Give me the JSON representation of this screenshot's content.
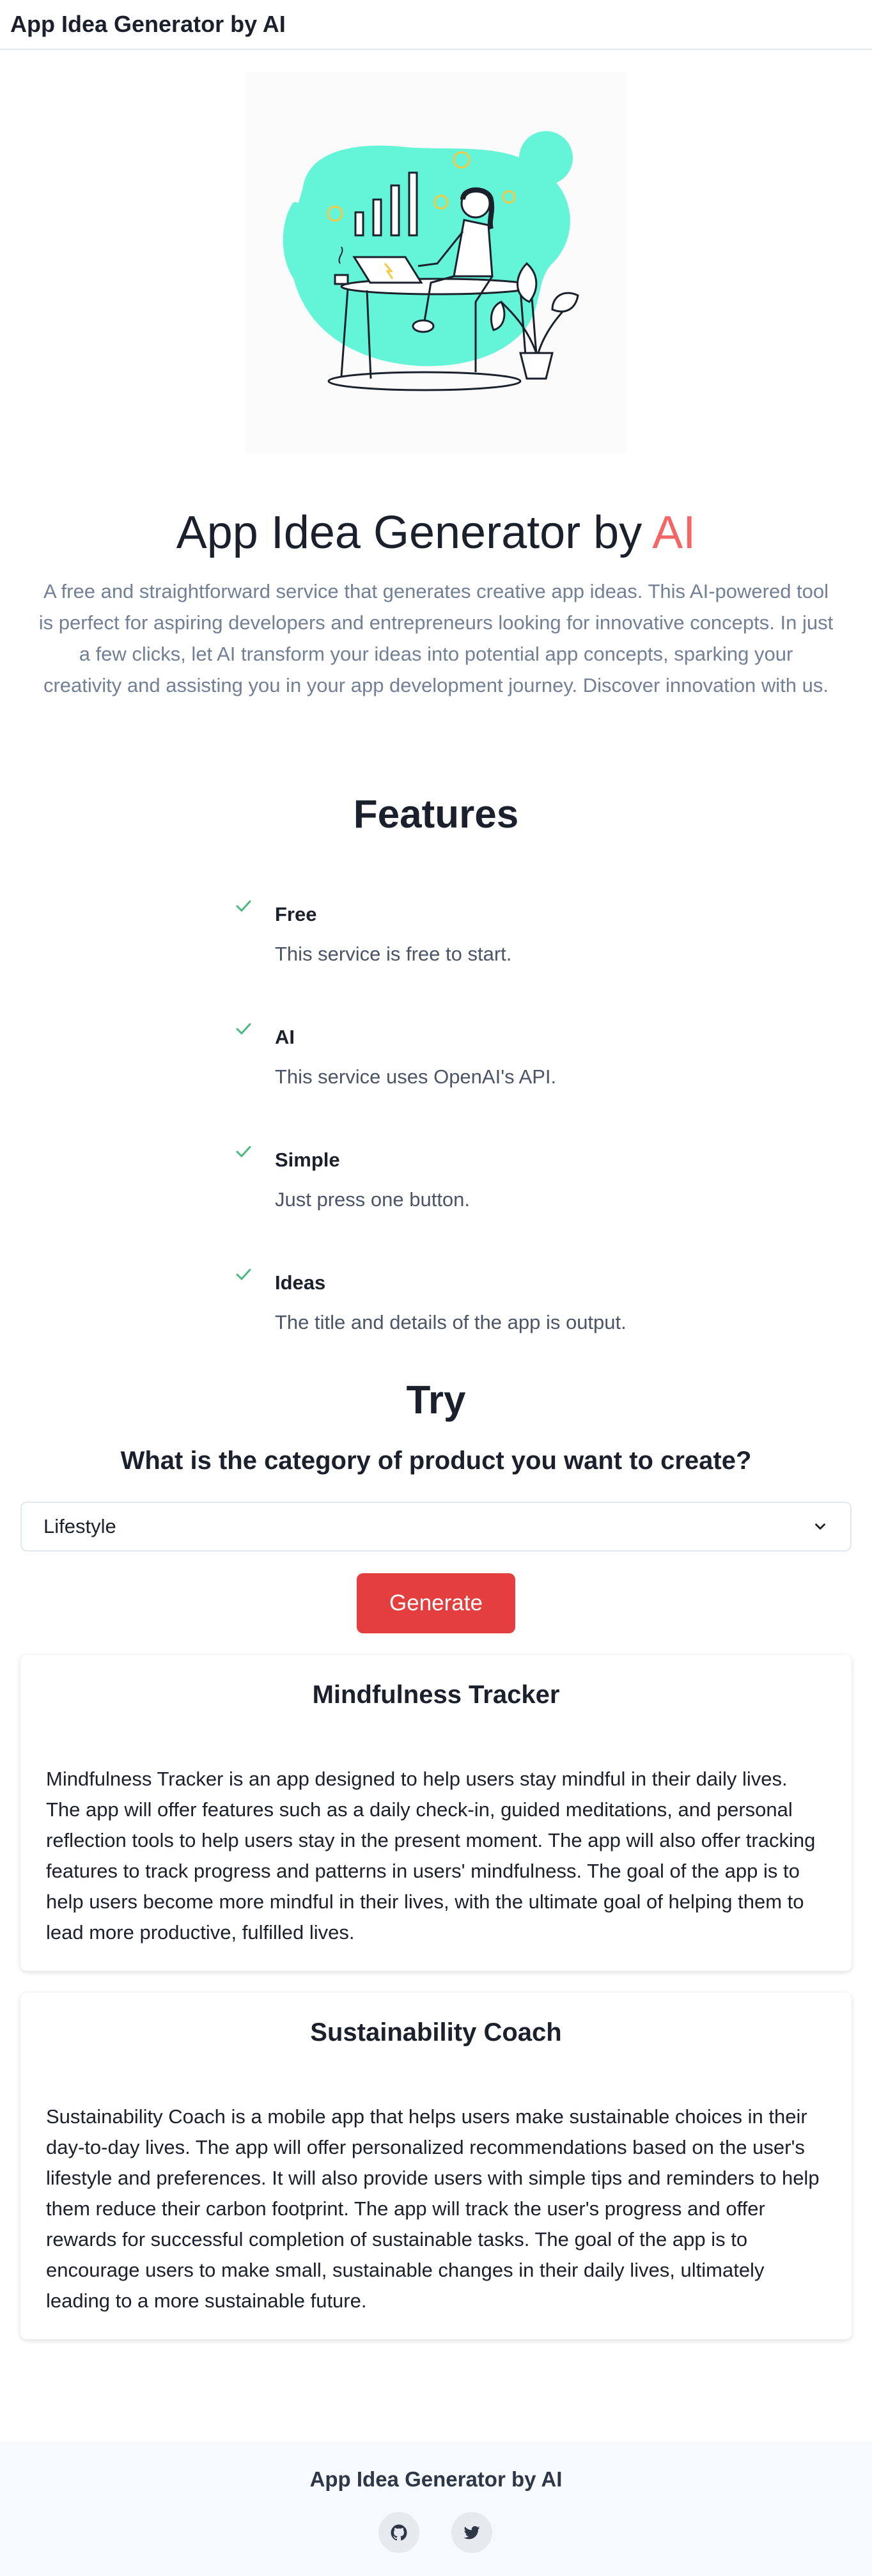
{
  "header": {
    "brand": "App Idea Generator by AI"
  },
  "hero": {
    "title_main": "App Idea Generator by ",
    "title_accent": "AI",
    "description": "A free and straightforward service that generates creative app ideas. This AI-powered tool is perfect for aspiring developers and entrepreneurs looking for innovative concepts. In just a few clicks, let AI transform your ideas into potential app concepts, sparking your creativity and assisting you in your app development journey. Discover innovation with us."
  },
  "features": {
    "title": "Features",
    "items": [
      {
        "title": "Free",
        "desc": "This service is free to start."
      },
      {
        "title": "AI",
        "desc": "This service uses OpenAI's API."
      },
      {
        "title": "Simple",
        "desc": "Just press one button."
      },
      {
        "title": "Ideas",
        "desc": "The title and details of the app is output."
      }
    ]
  },
  "try": {
    "title": "Try",
    "question": "What is the category of product you want to create?",
    "selected_category": "Lifestyle",
    "generate_label": "Generate"
  },
  "results": [
    {
      "title": "Mindfulness Tracker",
      "body": "Mindfulness Tracker is an app designed to help users stay mindful in their daily lives. The app will offer features such as a daily check-in, guided meditations, and personal reflection tools to help users stay in the present moment. The app will also offer tracking features to track progress and patterns in users' mindfulness. The goal of the app is to help users become more mindful in their lives, with the ultimate goal of helping them to lead more productive, fulfilled lives."
    },
    {
      "title": "Sustainability Coach",
      "body": "Sustainability Coach is a mobile app that helps users make sustainable choices in their day-to-day lives. The app will offer personalized recommendations based on the user's lifestyle and preferences. It will also provide users with simple tips and reminders to help them reduce their carbon footprint. The app will track the user's progress and offer rewards for successful completion of sustainable tasks. The goal of the app is to encourage users to make small, sustainable changes in their daily lives, ultimately leading to a more sustainable future."
    }
  ],
  "footer": {
    "brand": "App Idea Generator by AI"
  },
  "icons": {
    "check": "check-icon",
    "chevron": "chevron-down-icon",
    "github": "github-icon",
    "twitter": "twitter-icon"
  },
  "colors": {
    "accent": "#f56565",
    "button": "#e53e3e",
    "check": "#48bb78",
    "illustration_teal": "#64f5d8"
  }
}
